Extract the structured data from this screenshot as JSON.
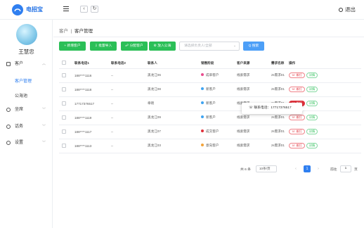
{
  "app": {
    "title": "电招宝",
    "logout": "退出"
  },
  "user": {
    "name": "王慧忠"
  },
  "sidebar": {
    "items": [
      {
        "label": "客户",
        "sub": [
          "客户管理",
          "公海池"
        ]
      },
      {
        "label": "坐席"
      },
      {
        "label": "话务"
      },
      {
        "label": "设置"
      }
    ]
  },
  "breadcrumb": {
    "root": "客户",
    "sep": "|",
    "current": "客户管理"
  },
  "toolbar": {
    "add": "+ 新增客户",
    "import": "⇩ 批量导入",
    "assign": "☍ 分配客户",
    "pool": "⚙ 放入公海",
    "owner_placeholder": "请选择负责人/全部",
    "search": "Q 搜索"
  },
  "table": {
    "headers": [
      "联系电话1",
      "联系电话2",
      "联系人",
      "销售阶段",
      "客户来源",
      "需求名称",
      "操作"
    ],
    "rows": [
      {
        "phone1": "188****1116",
        "phone2": "--",
        "contact": "黑龙江06",
        "stage": "成单客户",
        "stage_color": "#e94d8f",
        "source": "线索需求",
        "demand": "zs需求01"
      },
      {
        "phone1": "188****1118",
        "phone2": "--",
        "contact": "黑龙江08",
        "stage": "新客户",
        "stage_color": "#3fa4f1",
        "source": "线索需求",
        "demand": "zs需求01"
      },
      {
        "phone1": "17717376517",
        "phone2": "--",
        "contact": "章晓",
        "stage": "新客户",
        "stage_color": "#3fa4f1",
        "source": "线索需求",
        "demand": "zs需求01"
      },
      {
        "phone1": "188****1119",
        "phone2": "--",
        "contact": "黑龙江09",
        "stage": "新客户",
        "stage_color": "#3fa4f1",
        "source": "线索需求",
        "demand": "zs需求01"
      },
      {
        "phone1": "188****1117",
        "phone2": "--",
        "contact": "黑龙江07",
        "stage": "成交客户",
        "stage_color": "#e0323c",
        "source": "线索需求",
        "demand": "zs需求01"
      },
      {
        "phone1": "188****1113",
        "phone2": "--",
        "contact": "黑龙江03",
        "stage": "意向客户",
        "stage_color": "#f2a33a",
        "source": "线索需求",
        "demand": "zs需求01"
      }
    ],
    "action_call": "☏ 拨打",
    "action_detail": "详情"
  },
  "tooltip": {
    "text": "☏ 联系电话：17717376517"
  },
  "pagination": {
    "total": "共 6 条",
    "page_size": "10条/页",
    "current": "1",
    "goto_label": "前往",
    "goto_value": "1",
    "page_unit": "页"
  }
}
